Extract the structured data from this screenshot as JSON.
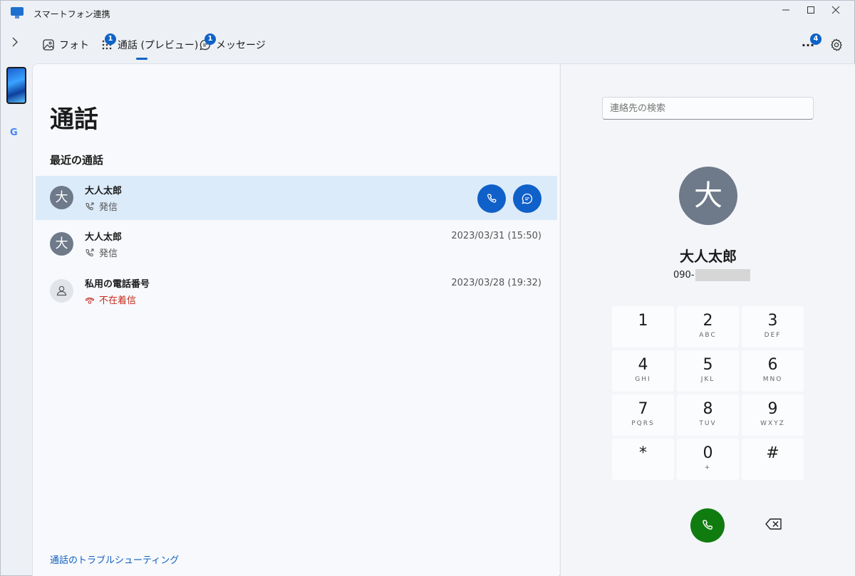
{
  "window": {
    "title": "スマートフォン連携"
  },
  "tabs": [
    {
      "label": "フォト",
      "icon": "photo-icon",
      "badge": ""
    },
    {
      "label": "通話 (プレビュー)",
      "icon": "dialpad-icon",
      "badge": "1"
    },
    {
      "label": "メッセージ",
      "icon": "message-icon",
      "badge": "1"
    }
  ],
  "toolbar": {
    "more_label": "...",
    "more_badge": "4"
  },
  "main": {
    "title": "通話",
    "recent_title": "最近の通話",
    "calls": [
      {
        "name": "大人太郎",
        "avatar": "大",
        "status": "発信",
        "type": "outgoing",
        "date": ""
      },
      {
        "name": "大人太郎",
        "avatar": "大",
        "status": "発信",
        "type": "outgoing",
        "date": "2023/03/31 (15:50)"
      },
      {
        "name": "私用の電話番号",
        "avatar": "",
        "status": "不在着信",
        "type": "missed",
        "date": "2023/03/28 (19:32)"
      }
    ],
    "troubleshoot_link": "通話のトラブルシューティング"
  },
  "dialer": {
    "search_placeholder": "連絡先の検索",
    "contact_avatar": "大",
    "contact_name": "大人太郎",
    "contact_number_prefix": "090-",
    "keys": [
      {
        "digit": "1",
        "letters": ""
      },
      {
        "digit": "2",
        "letters": "ABC"
      },
      {
        "digit": "3",
        "letters": "DEF"
      },
      {
        "digit": "4",
        "letters": "GHI"
      },
      {
        "digit": "5",
        "letters": "JKL"
      },
      {
        "digit": "6",
        "letters": "MNO"
      },
      {
        "digit": "7",
        "letters": "PQRS"
      },
      {
        "digit": "8",
        "letters": "TUV"
      },
      {
        "digit": "9",
        "letters": "WXYZ"
      },
      {
        "digit": "*",
        "letters": ""
      },
      {
        "digit": "0",
        "letters": "+"
      },
      {
        "digit": "#",
        "letters": ""
      }
    ]
  },
  "colors": {
    "accent": "#0f63c7",
    "call_green": "#107c10",
    "missed_red": "#c42b1c",
    "selected_row": "#dcebfa"
  }
}
